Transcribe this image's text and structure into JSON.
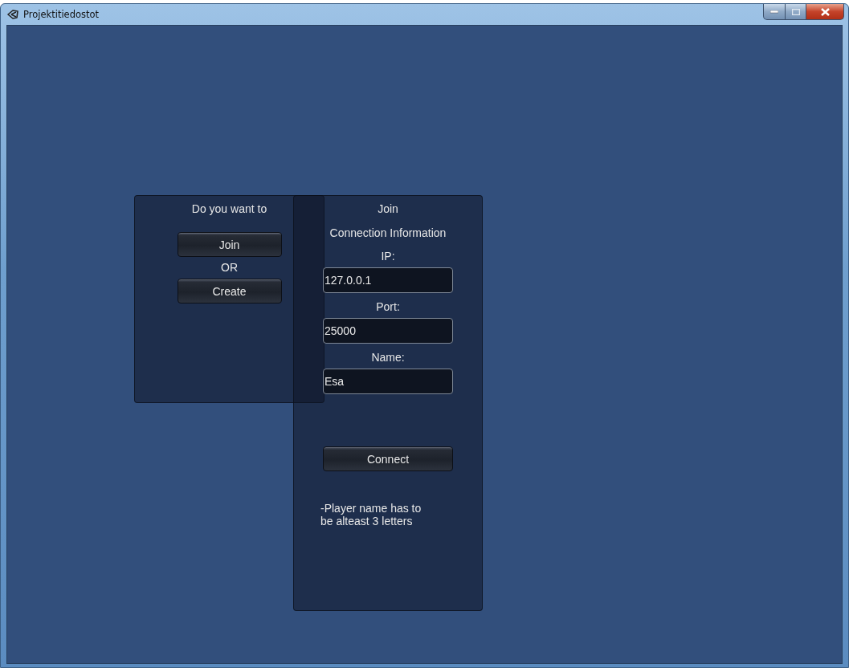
{
  "window": {
    "title": "Projektitiedostot"
  },
  "choice_panel": {
    "heading": "Do you want to",
    "buttons": [
      {
        "label": "Join"
      },
      {
        "label": "Create"
      }
    ],
    "separator": "OR"
  },
  "join_panel": {
    "title": "Join",
    "subtitle": "Connection Information",
    "fields": [
      {
        "label": "IP:",
        "value": "127.0.0.1"
      },
      {
        "label": "Port:",
        "value": "25000"
      },
      {
        "label": "Name:",
        "value": "Esa"
      }
    ],
    "connect_button": "Connect",
    "message": "-Player name has to be alteast 3 letters"
  }
}
